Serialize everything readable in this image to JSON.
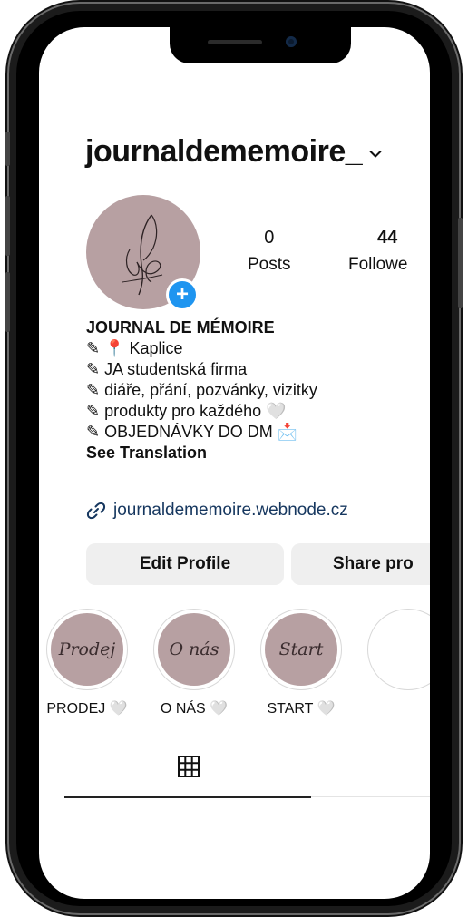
{
  "profile": {
    "username": "journaldememoire_",
    "posts_count": "0",
    "posts_label": "Posts",
    "followers_count": "44",
    "followers_label": "Followe"
  },
  "bio": {
    "name": "JOURNAL DE MÉMOIRE",
    "lines": [
      "✎ 📍 Kaplice",
      "✎ JA studentská firma",
      "✎ diáře, přání, pozvánky, vizitky",
      "✎ produkty pro každého 🤍",
      "✎ OBJEDNÁVKY DO DM 📩"
    ],
    "see_translation": "See Translation",
    "link": "journaldememoire.webnode.cz"
  },
  "buttons": {
    "edit_profile": "Edit Profile",
    "share_profile": "Share pro"
  },
  "highlights": [
    {
      "cover_text": "Prodej",
      "label": "PRODEJ 🤍"
    },
    {
      "cover_text": "O nás",
      "label": "O NÁS 🤍"
    },
    {
      "cover_text": "Start",
      "label": "START 🤍"
    }
  ],
  "tabs": {
    "active": "grid-icon"
  },
  "colors": {
    "avatar": "#b7a0a2",
    "badge": "#1f95f0",
    "link": "#16375f"
  }
}
